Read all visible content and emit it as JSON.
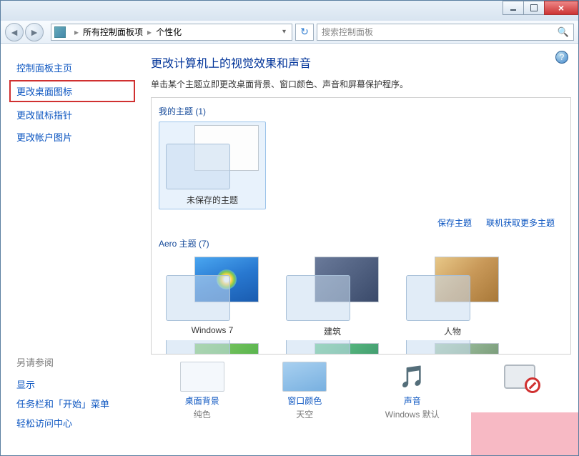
{
  "breadcrumb": {
    "root_icon": "control-panel",
    "item1": "所有控制面板项",
    "item2": "个性化"
  },
  "search": {
    "placeholder": "搜索控制面板"
  },
  "sidebar": {
    "links": [
      {
        "label": "控制面板主页"
      },
      {
        "label": "更改桌面图标",
        "highlighted": true
      },
      {
        "label": "更改鼠标指针"
      },
      {
        "label": "更改帐户图片"
      }
    ],
    "see_also_heading": "另请参阅",
    "see_also": [
      {
        "label": "显示"
      },
      {
        "label": "任务栏和「开始」菜单"
      },
      {
        "label": "轻松访问中心"
      }
    ]
  },
  "main": {
    "heading": "更改计算机上的视觉效果和声音",
    "subtitle": "单击某个主题立即更改桌面背景、窗口颜色、声音和屏幕保护程序。",
    "group_my_themes": "我的主题 (1)",
    "group_aero": "Aero 主题 (7)",
    "my_themes": [
      {
        "name": "未保存的主题",
        "selected": true
      }
    ],
    "actions": {
      "save": "保存主题",
      "get_more": "联机获取更多主题"
    },
    "aero_themes": [
      {
        "name": "Windows 7",
        "thumb": "win7"
      },
      {
        "name": "建筑",
        "thumb": "arch"
      },
      {
        "name": "人物",
        "thumb": "people"
      }
    ]
  },
  "bottom": {
    "items": [
      {
        "label": "桌面背景",
        "value": "纯色",
        "icon": "bg"
      },
      {
        "label": "窗口颜色",
        "value": "天空",
        "icon": "wincolor"
      },
      {
        "label": "声音",
        "value": "Windows 默认",
        "icon": "sound"
      },
      {
        "label": "",
        "value": "",
        "icon": "saver"
      }
    ]
  }
}
